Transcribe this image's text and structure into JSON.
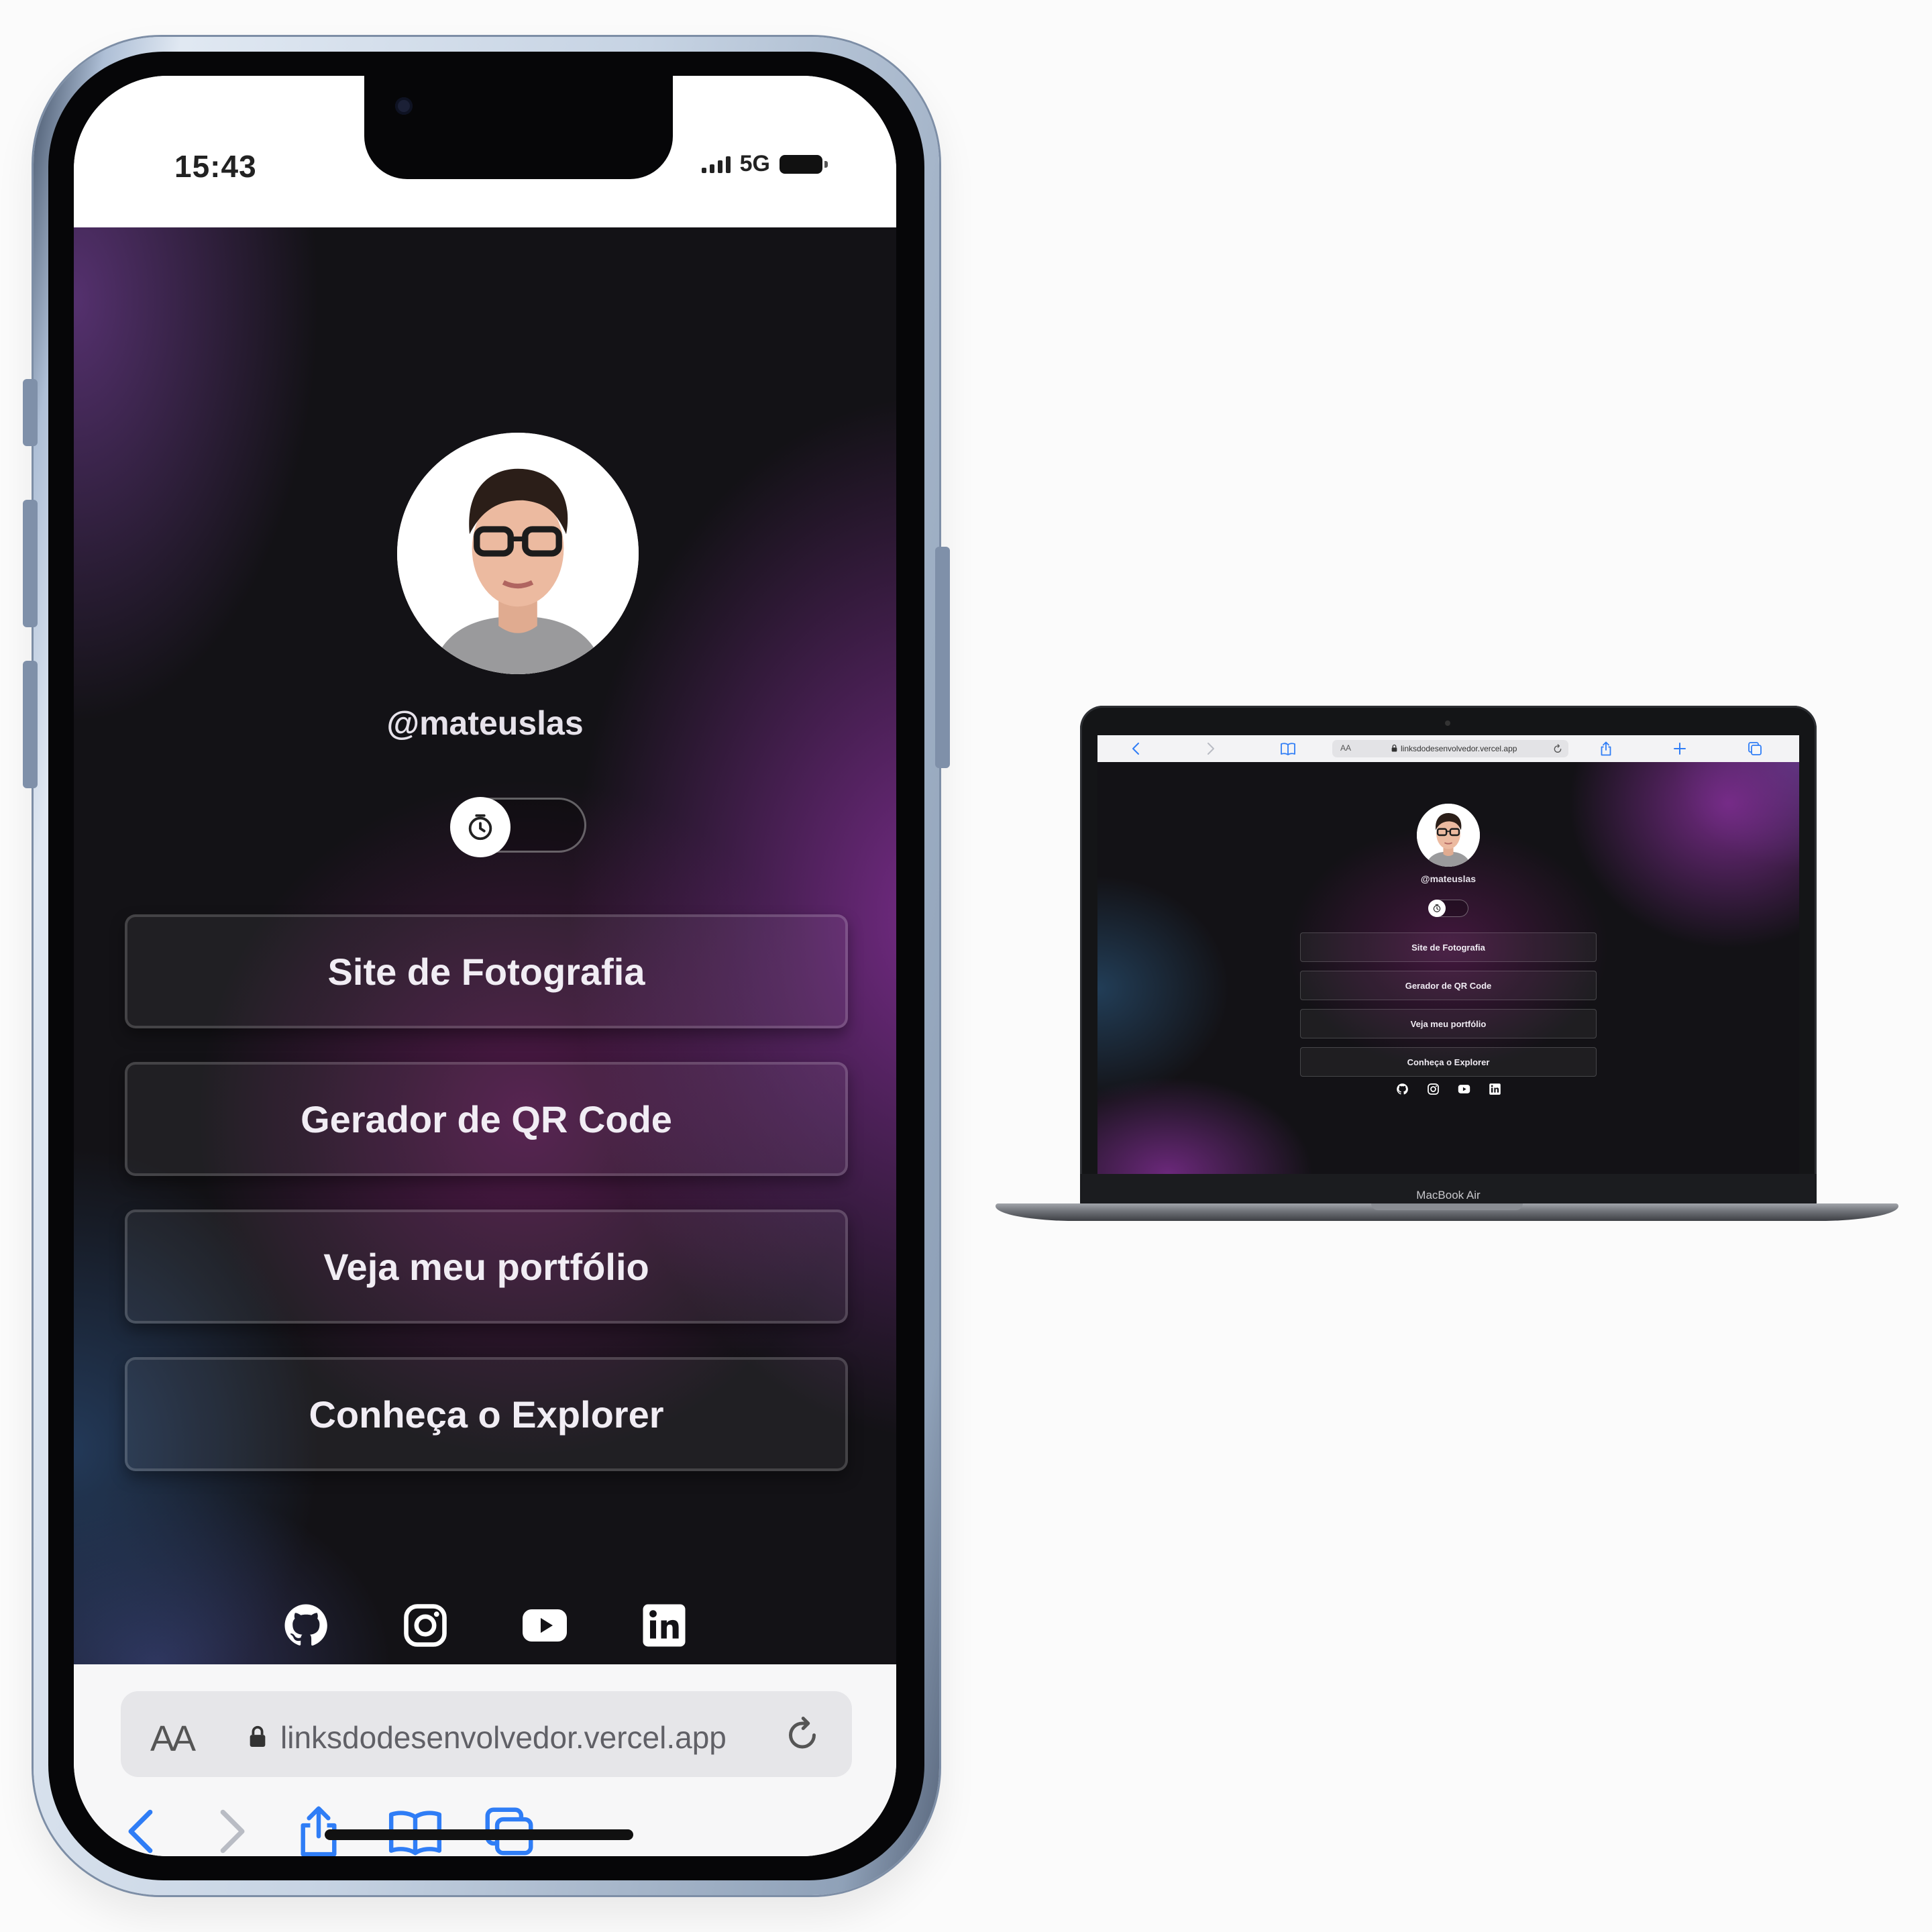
{
  "phone": {
    "status": {
      "time": "15:43",
      "network": "5G"
    },
    "page": {
      "username": "@mateuslas",
      "theme_toggle_icon": "clock-icon",
      "links": [
        {
          "label": "Site de Fotografia"
        },
        {
          "label": "Gerador de QR Code"
        },
        {
          "label": "Veja meu portfólio"
        },
        {
          "label": "Conheça o Explorer"
        }
      ],
      "social": [
        "github-icon",
        "instagram-icon",
        "youtube-icon",
        "linkedin-icon"
      ]
    },
    "safari": {
      "text_size_label": "AA",
      "url": "linksdodesenvolvedor.vercel.app",
      "nav_icons": [
        "back-icon",
        "forward-icon",
        "share-icon",
        "bookmarks-icon",
        "tabs-icon"
      ]
    }
  },
  "laptop": {
    "safari": {
      "text_size_label": "AA",
      "url": "linksdodesenvolvedor.vercel.app",
      "toolbar_icons": [
        "back-icon",
        "forward-icon",
        "sidebar-icon",
        "share-icon",
        "new-tab-icon",
        "tabs-icon"
      ]
    },
    "page": {
      "username": "@mateuslas",
      "links": [
        {
          "label": "Site de Fotografia"
        },
        {
          "label": "Gerador de QR Code"
        },
        {
          "label": "Veja meu portfólio"
        },
        {
          "label": "Conheça o Explorer"
        }
      ]
    },
    "model_label": "MacBook Air"
  },
  "colors": {
    "background": "#fbfbfb",
    "page_dark": "#131216",
    "purple_glow": "#7a2c8c",
    "safari_blue": "#2f7df6"
  }
}
